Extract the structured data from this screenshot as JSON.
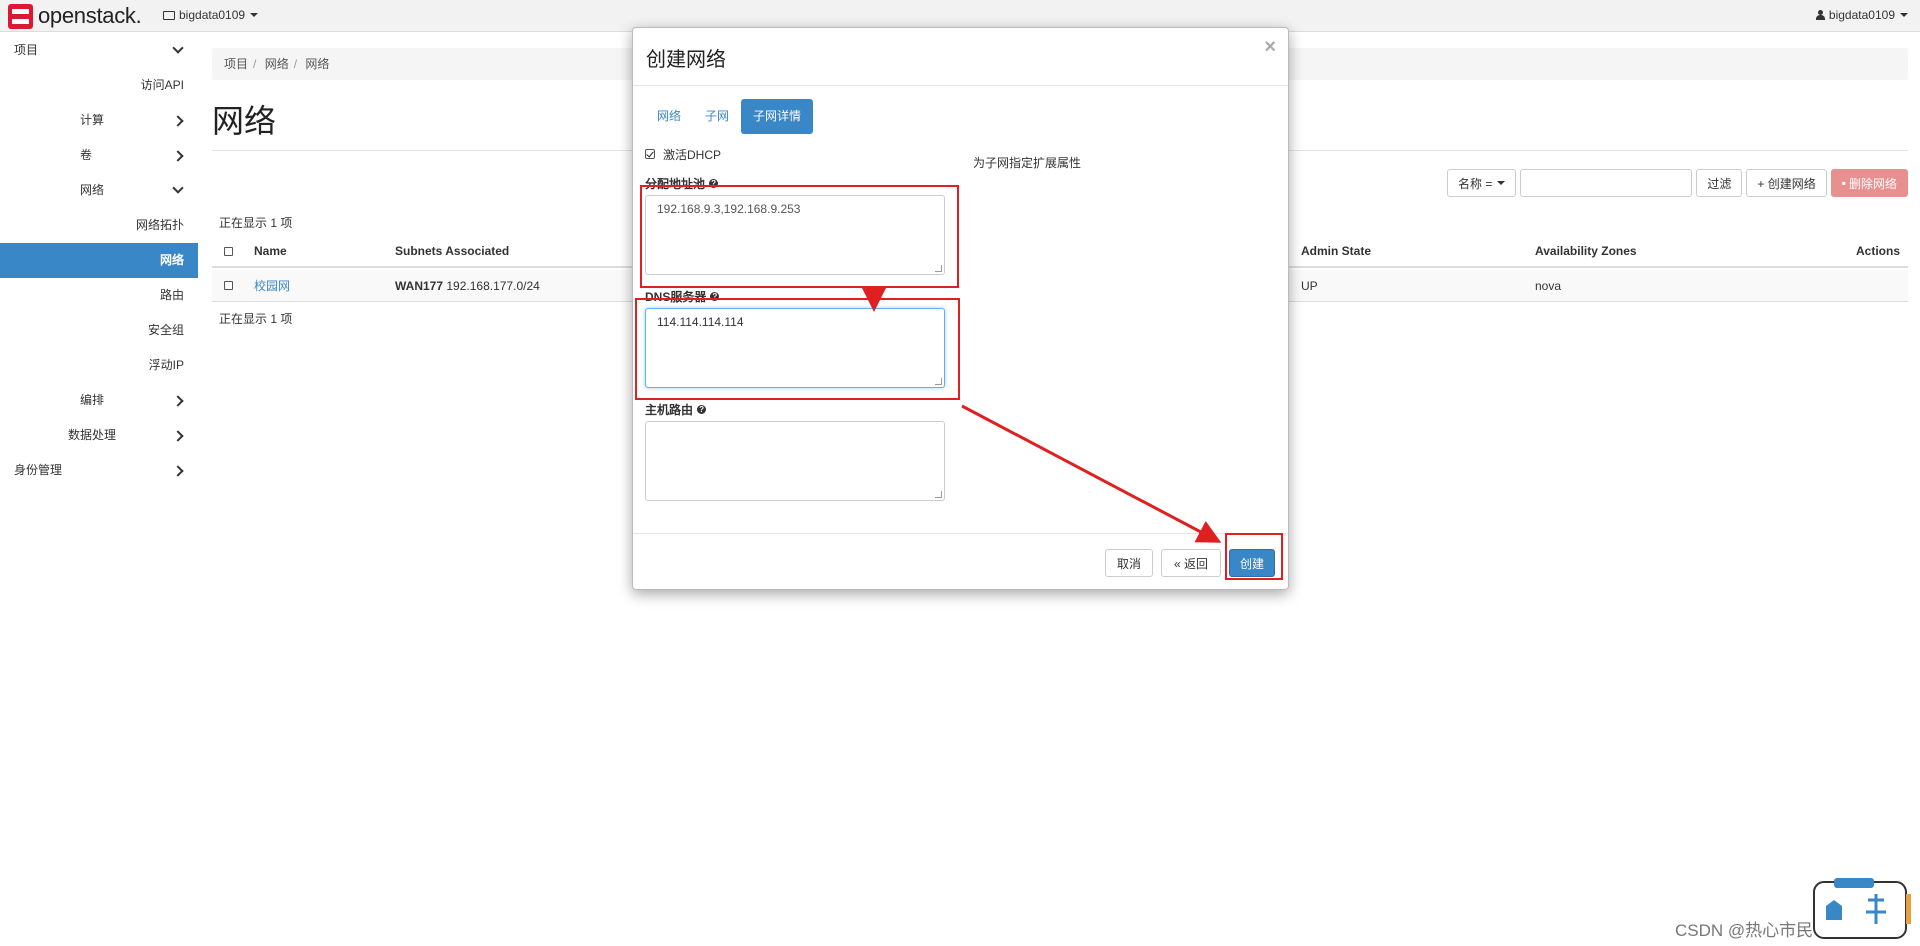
{
  "navbar": {
    "brand_prefix": "",
    "brand_name": "openstack.",
    "project": "bigdata0109",
    "user": "bigdata0109"
  },
  "sidebar": {
    "items": [
      {
        "label": "项目"
      },
      {
        "label": "访问API"
      },
      {
        "label": "计算"
      },
      {
        "label": "卷"
      },
      {
        "label": "网络"
      },
      {
        "label": "网络拓扑"
      },
      {
        "label": "网络"
      },
      {
        "label": "路由"
      },
      {
        "label": "安全组"
      },
      {
        "label": "浮动IP"
      },
      {
        "label": "编排"
      },
      {
        "label": "数据处理"
      },
      {
        "label": "身份管理"
      }
    ]
  },
  "main": {
    "breadcrumb": [
      "项目",
      "网络",
      "网络"
    ],
    "title": "网络",
    "toolbar": {
      "filter_field": "名称 =",
      "filter_button": "过滤",
      "create_button": "+ 创建网络",
      "delete_button": "删除网络"
    },
    "count_text": "正在显示 1 项",
    "columns": [
      "Name",
      "Subnets Associated",
      "Admin State",
      "Availability Zones",
      "Actions"
    ],
    "rows": [
      {
        "name": "校园网",
        "subnet_name": "WAN177",
        "subnet_cidr": "192.168.177.0/24",
        "admin_state": "UP",
        "zone": "nova"
      }
    ]
  },
  "modal": {
    "title": "创建网络",
    "close": "×",
    "tabs": [
      "网络",
      "子网",
      "子网详情"
    ],
    "active_tab": "子网详情",
    "dhcp_label": "激活DHCP",
    "dhcp_checked": true,
    "pool_label": "分配地址池",
    "pool_value": "192.168.9.3,192.168.9.253",
    "dns_label": "DNS服务器",
    "dns_value": "114.114.114.114",
    "routes_label": "主机路由",
    "routes_value": "",
    "help_text": "为子网指定扩展属性",
    "cancel": "取消",
    "back": "« 返回",
    "create": "创建"
  },
  "watermark": "CSDN @热心市民小韦同学",
  "colors": {
    "primary": "#3a87c7",
    "brand_red": "#da1a32",
    "annotation_red": "#e02020",
    "danger_button": "#e8908f"
  }
}
